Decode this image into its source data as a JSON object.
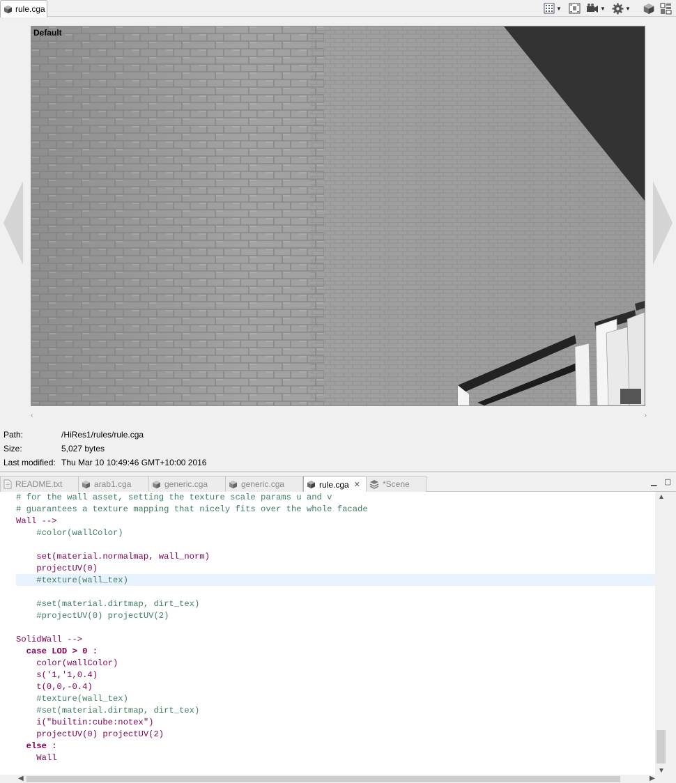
{
  "top_tab": {
    "label": "rule.cga"
  },
  "viewport": {
    "label": "Default"
  },
  "info": {
    "path_label": "Path:",
    "path_value": "/HiRes1/rules/rule.cga",
    "size_label": "Size:",
    "size_value": "5,027 bytes",
    "modified_label": "Last modified:",
    "modified_value": "Thu Mar 10 10:49:46 GMT+10:00 2016"
  },
  "editor_tabs": [
    {
      "label": "README.txt",
      "icon": "text-file-icon",
      "active": false
    },
    {
      "label": "arab1.cga",
      "icon": "cga-file-icon",
      "active": false
    },
    {
      "label": "generic.cga",
      "icon": "cga-file-icon",
      "active": false
    },
    {
      "label": "generic.cga",
      "icon": "cga-file-icon",
      "active": false
    },
    {
      "label": "rule.cga",
      "icon": "cga-file-icon",
      "active": true
    },
    {
      "label": "*Scene",
      "icon": "scene-layers-icon",
      "active": false
    }
  ],
  "code_lines": [
    "# for the wall asset, setting the texture scale params u and v",
    "# guarantees a texture mapping that nicely fits over the whole facade",
    "Wall -->",
    "    #color(wallColor)",
    "",
    "    set(material.normalmap, wall_norm)",
    "    projectUV(0)",
    "    #texture(wall_tex)",
    "",
    "    #set(material.dirtmap, dirt_tex)",
    "    #projectUV(0) projectUV(2)",
    "",
    "SolidWall -->",
    "  case LOD > 0 :",
    "    color(wallColor)",
    "    s('1,'1,0.4)",
    "    t(0,0,-0.4)",
    "    #texture(wall_tex)",
    "    #set(material.dirtmap, dirt_tex)",
    "    i(\"builtin:cube:notex\")",
    "    projectUV(0) projectUV(2)",
    "  else :",
    "    Wall"
  ],
  "colors": {
    "comment": "#3f7f5f",
    "keyword": "#7f0055",
    "highlight_line": "#e8f2fe"
  }
}
